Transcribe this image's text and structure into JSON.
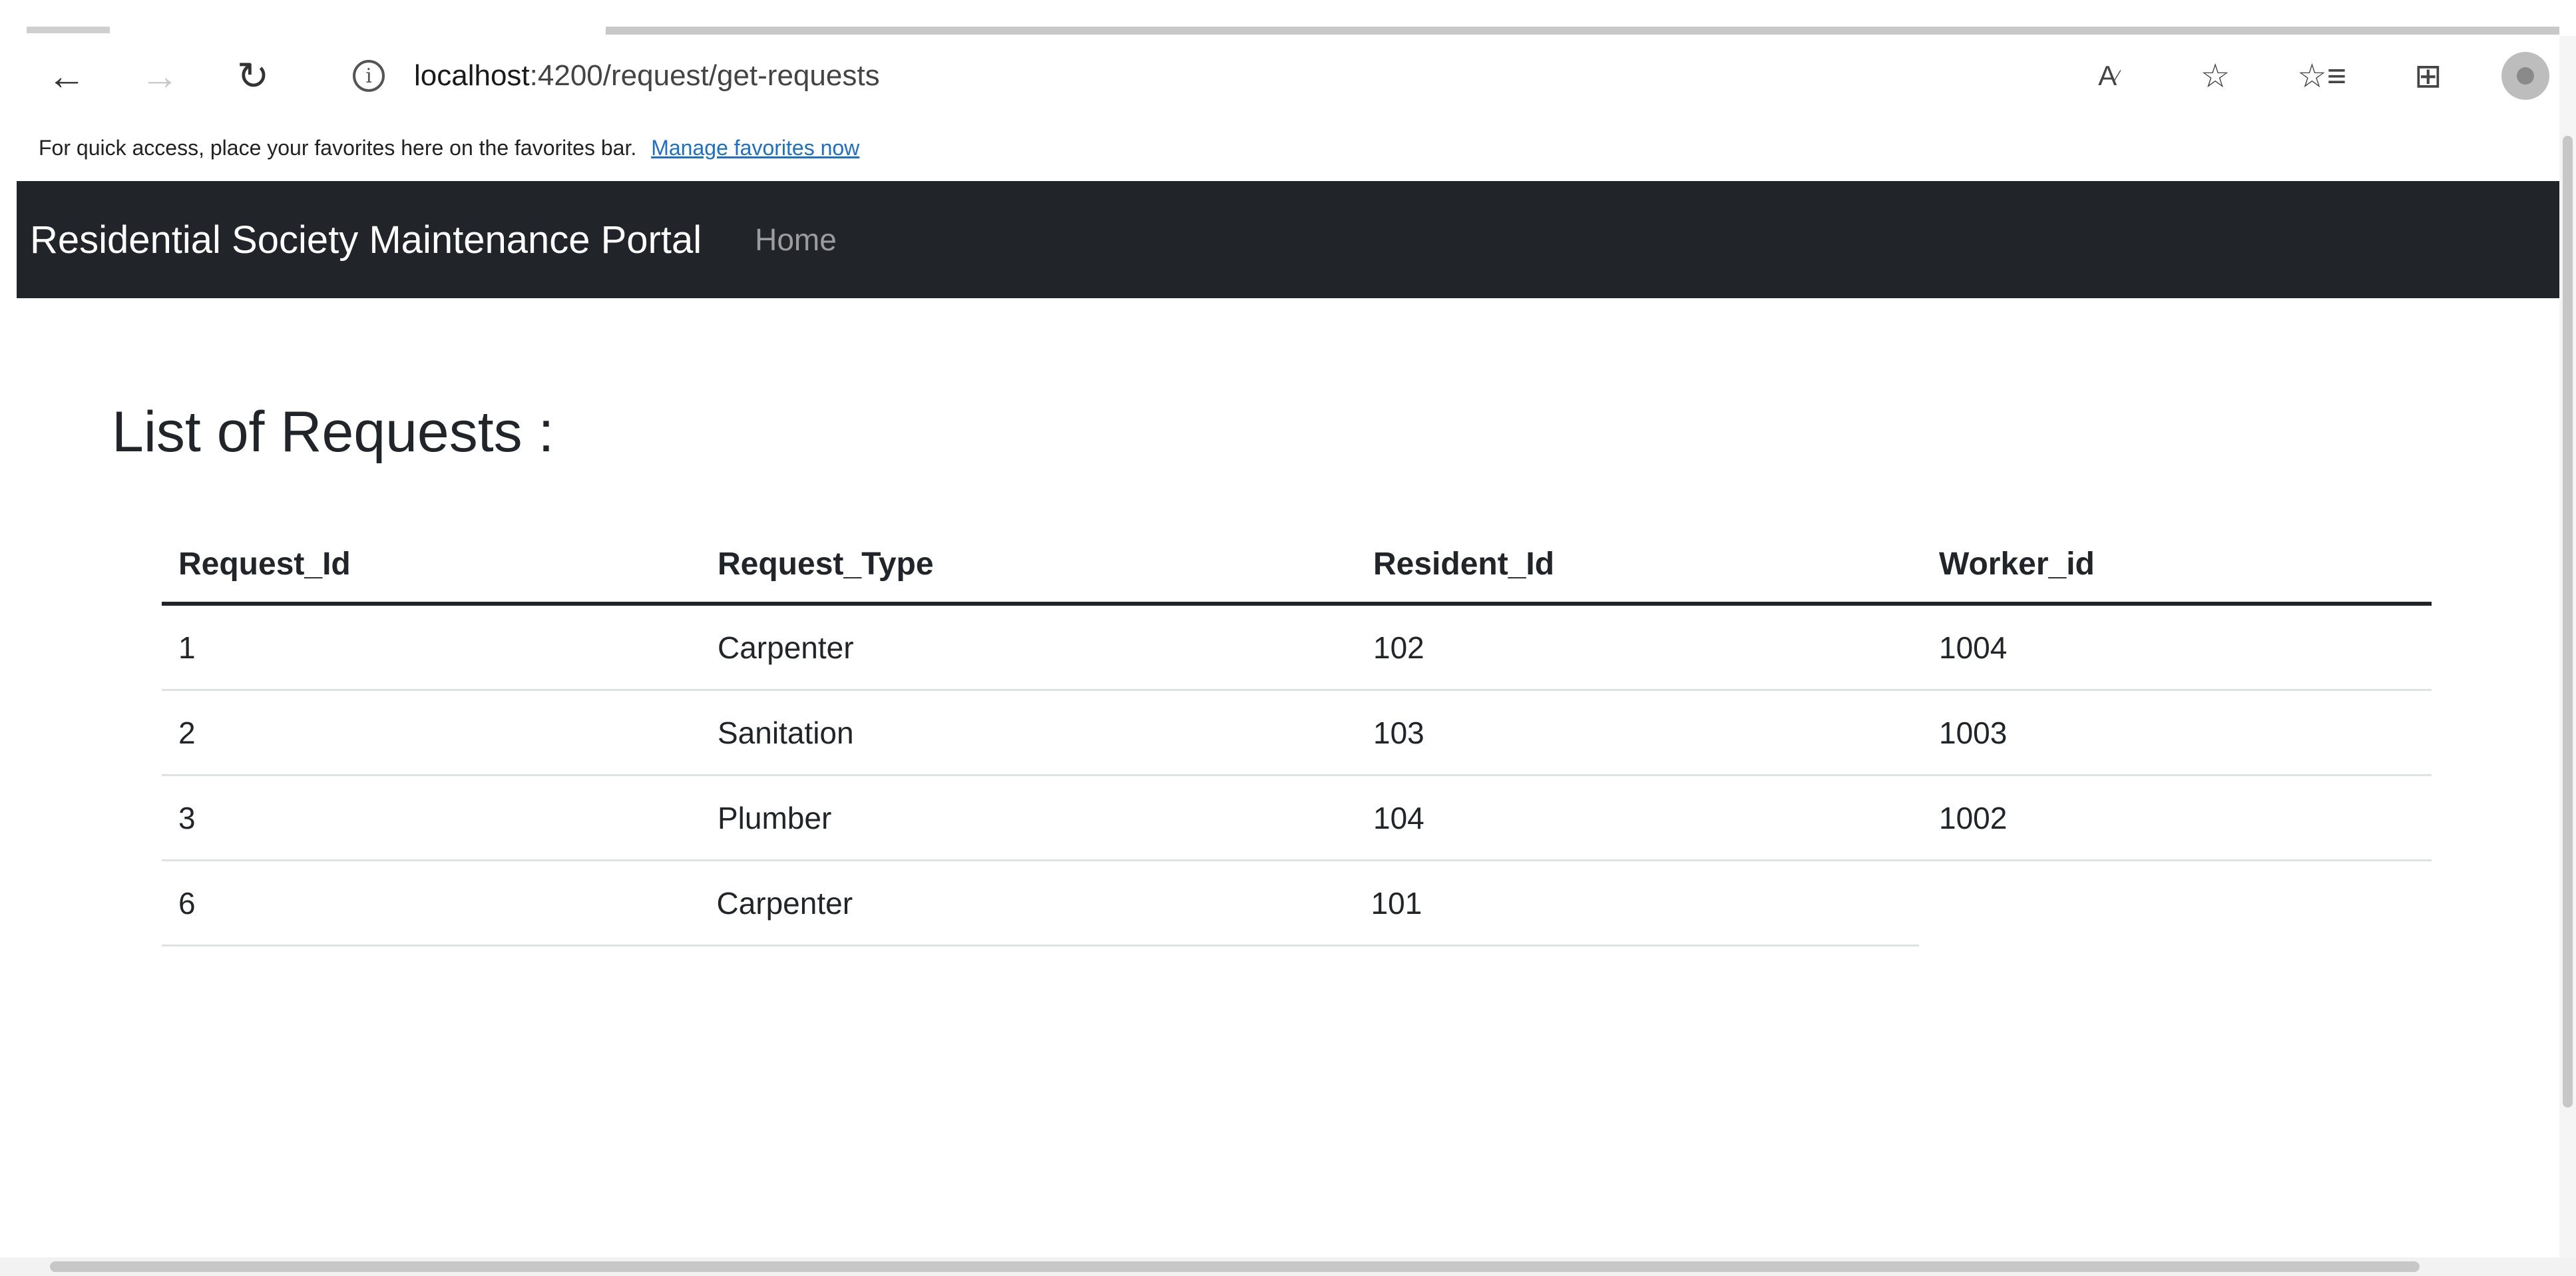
{
  "browser": {
    "url_host": "localhost",
    "url_rest": ":4200/request/get-requests",
    "icons": {
      "back": "back-arrow-icon",
      "forward": "forward-arrow-icon",
      "refresh": "refresh-icon",
      "info": "info-icon",
      "read_aloud": "read-aloud-icon",
      "add_favorite": "add-favorite-icon",
      "favorites": "favorites-icon",
      "collections": "collections-icon",
      "profile": "profile-icon"
    },
    "favorites_bar": {
      "message": "For quick access, place your favorites here on the favorites bar.",
      "link": "Manage favorites now"
    }
  },
  "app": {
    "brand": "Residential Society Maintenance Portal",
    "nav_home": "Home",
    "navbar_color": "#212529"
  },
  "main": {
    "title": "List of Requests :",
    "table": {
      "headers": [
        "Request_Id",
        "Request_Type",
        "Resident_Id",
        "Worker_id"
      ],
      "rows": [
        [
          "1",
          "Carpenter",
          "102",
          "1004"
        ],
        [
          "2",
          "Sanitation",
          "103",
          "1003"
        ],
        [
          "3",
          "Plumber",
          "104",
          "1002"
        ],
        [
          "6",
          "Carpenter",
          "101",
          ""
        ]
      ]
    }
  }
}
